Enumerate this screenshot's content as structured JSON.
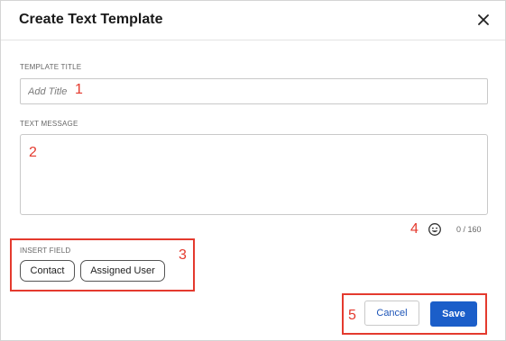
{
  "dialog": {
    "title": "Create Text Template",
    "close_icon": "close-icon"
  },
  "template_title": {
    "label": "TEMPLATE TITLE",
    "placeholder": "Add Title",
    "value": ""
  },
  "text_message": {
    "label": "TEXT MESSAGE",
    "value": ""
  },
  "counter": "0 / 160",
  "emoji_icon": "emoji-smiley-icon",
  "insert_field": {
    "label": "INSERT FIELD",
    "chips": [
      "Contact",
      "Assigned User"
    ]
  },
  "actions": {
    "cancel_label": "Cancel",
    "save_label": "Save"
  },
  "annotations": [
    "1",
    "2",
    "3",
    "4",
    "5"
  ],
  "colors": {
    "accent": "#1b5ec9",
    "annotation": "#e43a2e"
  }
}
